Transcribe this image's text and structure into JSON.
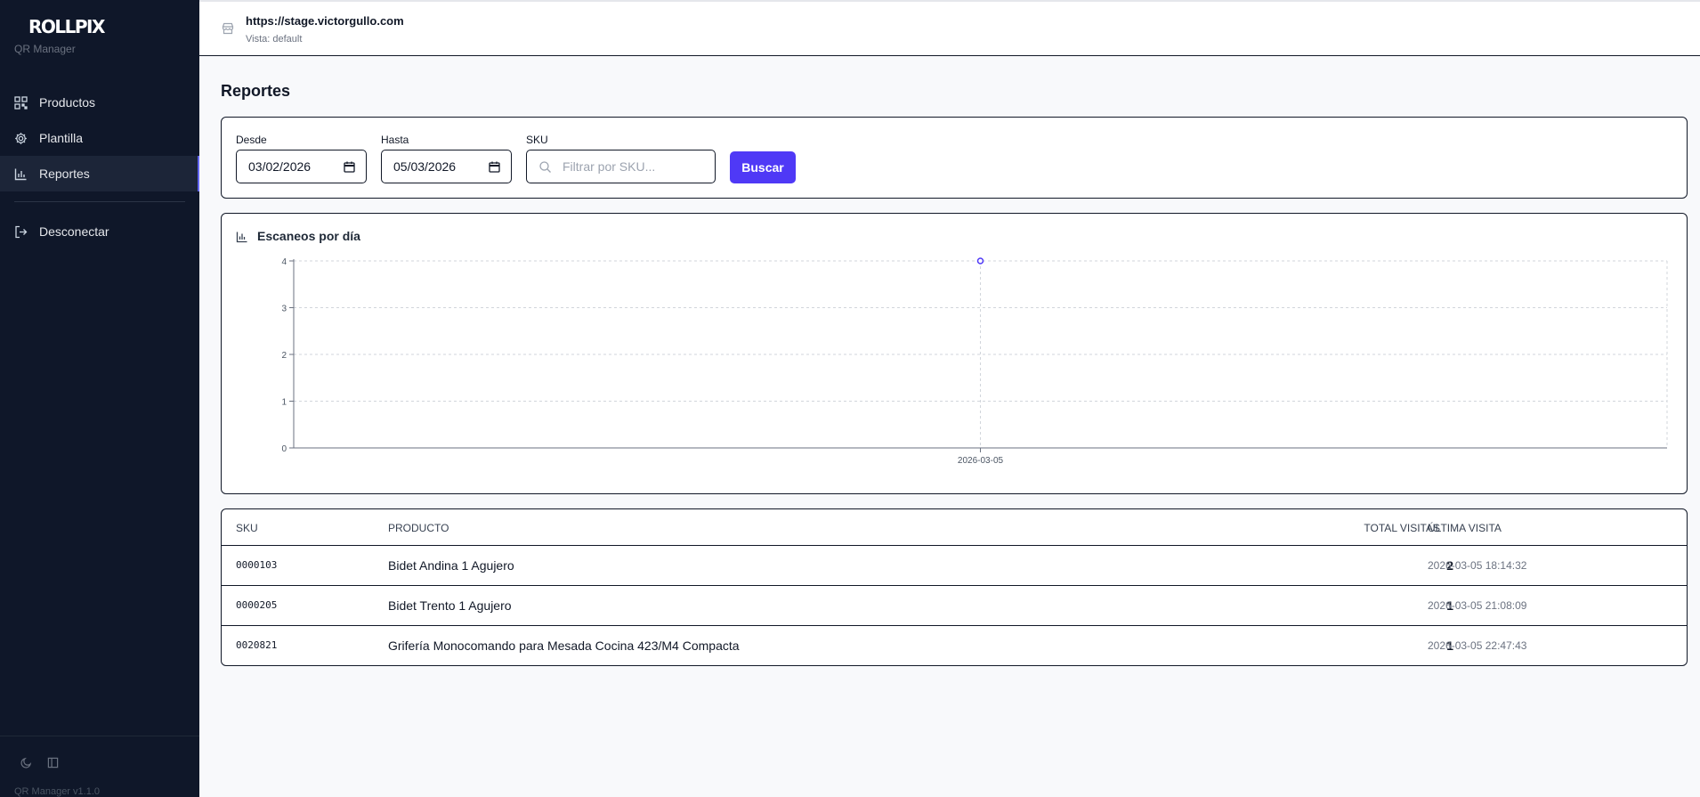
{
  "sidebar": {
    "logo": "ROLLPIX",
    "subtitle": "QR Manager",
    "items": [
      {
        "label": "Productos",
        "icon": "qr-code-icon"
      },
      {
        "label": "Plantilla",
        "icon": "gear-icon"
      },
      {
        "label": "Reportes",
        "icon": "bar-chart-icon"
      },
      {
        "label": "Desconectar",
        "icon": "logout-icon"
      }
    ],
    "active": "Reportes",
    "version": "QR Manager v1.1.0"
  },
  "header": {
    "host": "https://stage.victorgullo.com",
    "vista": "Vista: default"
  },
  "page": {
    "title": "Reportes"
  },
  "filters": {
    "desde_label": "Desde",
    "desde_value": "03/02/2026",
    "hasta_label": "Hasta",
    "hasta_value": "05/03/2026",
    "sku_label": "SKU",
    "sku_placeholder": "Filtrar por SKU...",
    "search_button": "Buscar"
  },
  "chart_title": "Escaneos por día",
  "chart_data": {
    "type": "line",
    "x": [
      "2026-03-05"
    ],
    "series": [
      {
        "values": [
          4
        ]
      }
    ],
    "ylim": [
      0,
      4
    ],
    "yticks": [
      0,
      1,
      2,
      3,
      4
    ],
    "grid": true,
    "accent": "#4f39f6"
  },
  "table": {
    "headers": [
      "SKU",
      "PRODUCTO",
      "TOTAL VISITAS",
      "ÚLTIMA VISITA"
    ],
    "rows": [
      {
        "sku": "0000103",
        "producto": "Bidet Andina 1 Agujero",
        "total": "2",
        "ultima": "2026-03-05 18:14:32"
      },
      {
        "sku": "0000205",
        "producto": "Bidet Trento 1 Agujero",
        "total": "1",
        "ultima": "2026-03-05 21:08:09"
      },
      {
        "sku": "0020821",
        "producto": "Grifería Monocomando para Mesada Cocina 423/M4 Compacta",
        "total": "1",
        "ultima": "2026-03-05 22:47:43"
      }
    ]
  }
}
